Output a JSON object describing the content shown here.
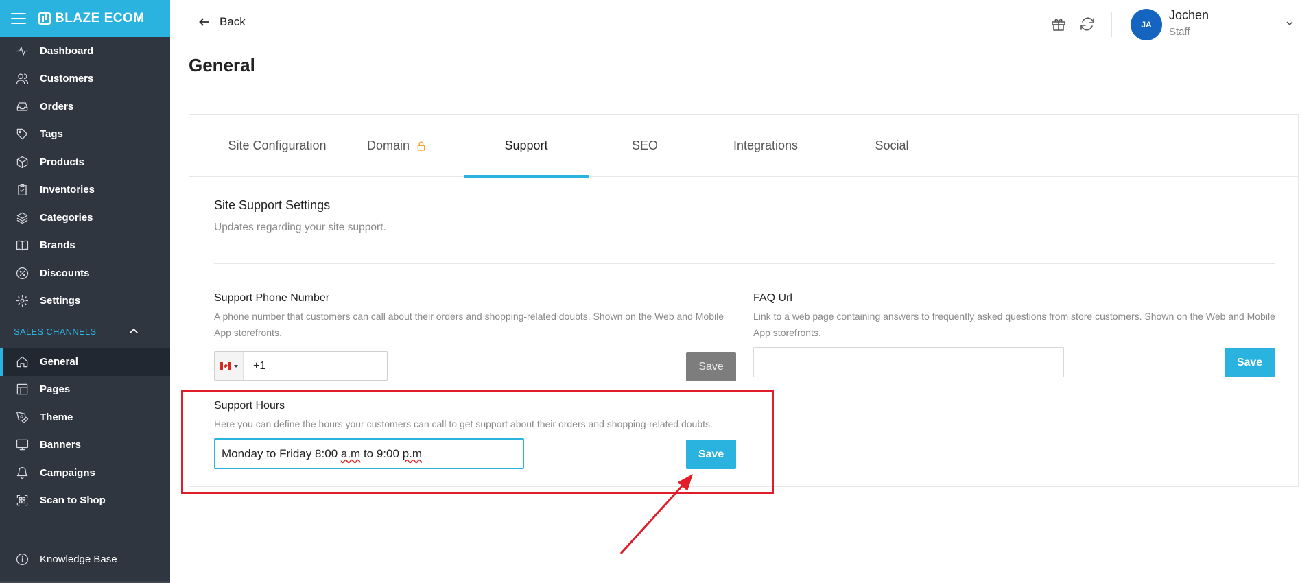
{
  "app": {
    "brand": "BLAZE ECOM"
  },
  "sidebar": {
    "items": [
      {
        "label": "Dashboard",
        "icon": "activity-icon"
      },
      {
        "label": "Customers",
        "icon": "users-icon"
      },
      {
        "label": "Orders",
        "icon": "inbox-icon"
      },
      {
        "label": "Tags",
        "icon": "tag-icon"
      },
      {
        "label": "Products",
        "icon": "box-icon"
      },
      {
        "label": "Inventories",
        "icon": "clipboard-icon"
      },
      {
        "label": "Categories",
        "icon": "layers-icon"
      },
      {
        "label": "Brands",
        "icon": "book-icon"
      },
      {
        "label": "Discounts",
        "icon": "percent-icon"
      },
      {
        "label": "Settings",
        "icon": "gear-icon"
      }
    ],
    "section_label": "SALES CHANNELS",
    "channel_items": [
      {
        "label": "General",
        "icon": "home-icon",
        "active": true
      },
      {
        "label": "Pages",
        "icon": "layout-icon"
      },
      {
        "label": "Theme",
        "icon": "pen-icon"
      },
      {
        "label": "Banners",
        "icon": "monitor-icon"
      },
      {
        "label": "Campaigns",
        "icon": "bell-icon"
      },
      {
        "label": "Scan to Shop",
        "icon": "qr-scan-icon"
      }
    ],
    "knowledge_base": "Knowledge Base"
  },
  "header": {
    "back_label": "Back",
    "user": {
      "initials": "JA",
      "name": "Jochen",
      "role": "Staff"
    }
  },
  "page": {
    "title": "General"
  },
  "tabs": [
    {
      "label": "Site Configuration"
    },
    {
      "label": "Domain",
      "locked": true
    },
    {
      "label": "Support",
      "active": true
    },
    {
      "label": "SEO"
    },
    {
      "label": "Integrations"
    },
    {
      "label": "Social"
    }
  ],
  "support": {
    "title": "Site Support Settings",
    "subtitle": "Updates regarding your site support.",
    "phone": {
      "label": "Support Phone Number",
      "help_line1": "A phone number that customers can call about their orders and shopping-related doubts. Shown on the Web and Mobile",
      "help_line2": "App storefronts.",
      "value": "+1",
      "save_label": "Save"
    },
    "faq": {
      "label": "FAQ Url",
      "help_line1": "Link to a web page containing answers to frequently asked questions from store customers. Shown on the Web and Mobile",
      "help_line2": "App storefronts.",
      "value": "",
      "save_label": "Save"
    },
    "hours": {
      "label": "Support Hours",
      "help": "Here you can define the hours your customers can call to get support about their orders and shopping-related doubts.",
      "value_part1": "Monday to Friday 8:00 ",
      "value_part2": "a.m",
      "value_part3": " to 9:00 ",
      "value_part4": "p.m",
      "save_label": "Save"
    }
  },
  "colors": {
    "accent": "#2bb3e0",
    "sidebar_bg": "#2f3640",
    "annotation": "#e11d2a"
  }
}
